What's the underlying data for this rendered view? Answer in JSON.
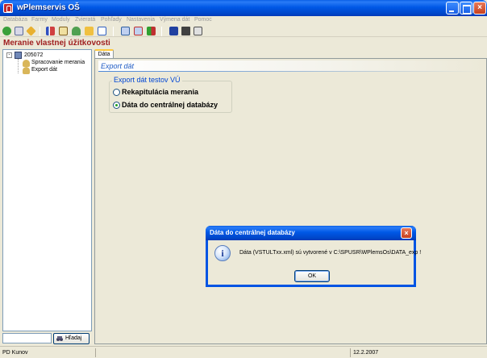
{
  "app": {
    "title": "wPlemservis OŠ"
  },
  "menu": [
    "Databáza",
    "Farmy",
    "Moduly",
    "Zvieratá",
    "Pohľady",
    "Nastavenia",
    "Výmena dát",
    "Pomoc"
  ],
  "toolbar": {
    "icons": [
      "check-icon",
      "calendar-icon",
      "diamond-icon",
      "chart-icon",
      "edit-icon",
      "users-icon",
      "folder-icon",
      "window-icon",
      "grid-icon",
      "grid-delete-icon",
      "grid-chart-icon",
      "save-icon",
      "tools-icon",
      "print-icon"
    ]
  },
  "header": {
    "title": "Meranie vlastnej úžitkovosti"
  },
  "tree": {
    "root": {
      "expander": "-",
      "label": "205072"
    },
    "children": [
      {
        "label": "Spracovanie merania"
      },
      {
        "label": "Export dát"
      }
    ]
  },
  "search": {
    "value": "",
    "button_label": "Hľadaj"
  },
  "tabs": [
    {
      "label": "Dáta",
      "active": true
    }
  ],
  "section": {
    "title": "Export dát"
  },
  "groupbox": {
    "title": "Export dát testov VÚ",
    "options": [
      {
        "label": "Rekapitulácia merania",
        "checked": false
      },
      {
        "label": "Dáta do centrálnej databázy",
        "checked": true
      }
    ]
  },
  "statusbar": {
    "user": "PD Kunov",
    "middle": "",
    "date": "12.2.2007"
  },
  "dialog": {
    "title": "Dáta do centrálnej databázy",
    "icon": "info-icon",
    "icon_glyph": "i",
    "close_glyph": "×",
    "message": "Dáta (VSTULTxx.xml) sú vytvorené v C:\\SPUSR\\WPlemsOs\\DATA_exp !",
    "ok_label": "OK"
  },
  "colors": {
    "titlebar": "#0058e6",
    "header_text": "#a02020",
    "section_title": "#215dc6",
    "groupbox_title": "#0046d5"
  }
}
